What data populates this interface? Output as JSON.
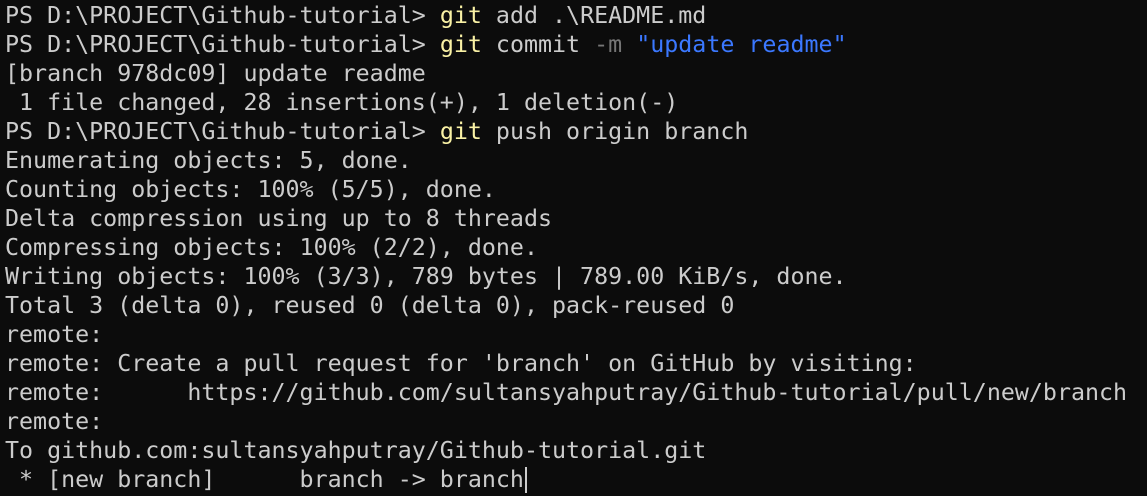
{
  "terminal": {
    "prompt": "PS D:\\PROJECT\\Github-tutorial> ",
    "cmd1": {
      "command": "git",
      "args": " add .\\README.md"
    },
    "cmd2": {
      "command": "git",
      "args": " commit ",
      "flag": "-m",
      "string": "\"update readme\""
    },
    "out1": "[branch 978dc09] update readme",
    "out2": " 1 file changed, 28 insertions(+), 1 deletion(-)",
    "cmd3": {
      "command": "git",
      "args": " push origin branch"
    },
    "push_output": [
      "Enumerating objects: 5, done.",
      "Counting objects: 100% (5/5), done.",
      "Delta compression using up to 8 threads",
      "Compressing objects: 100% (2/2), done.",
      "Writing objects: 100% (3/3), 789 bytes | 789.00 KiB/s, done.",
      "Total 3 (delta 0), reused 0 (delta 0), pack-reused 0",
      "remote:",
      "remote: Create a pull request for 'branch' on GitHub by visiting:",
      "remote:      https://github.com/sultansyahputray/Github-tutorial/pull/new/branch",
      "remote:",
      "To github.com:sultansyahputray/Github-tutorial.git"
    ],
    "last_line": " * [new branch]      branch -> branch"
  },
  "colors": {
    "background": "#0c0c0c",
    "text": "#cccccc",
    "command": "#f9f1a5",
    "flag": "#767676",
    "string": "#3b78ff"
  }
}
